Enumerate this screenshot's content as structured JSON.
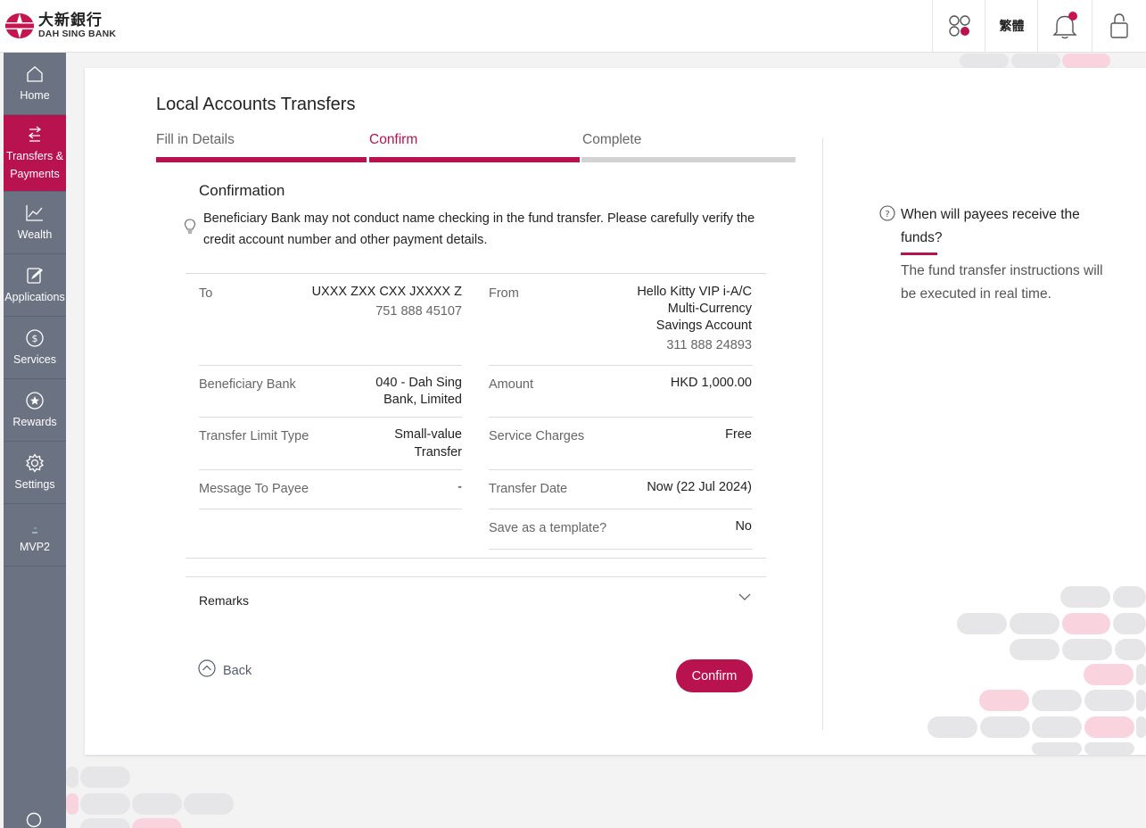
{
  "header": {
    "logo_cn": "大新銀行",
    "logo_en": "DAH SING BANK",
    "language_label": "繁體",
    "colors": {
      "brand": "#b8124f",
      "sidebar": "#6b7282"
    }
  },
  "sidebar": {
    "items": [
      {
        "label": "Home",
        "icon": "home-icon"
      },
      {
        "label": "Transfers & Payments",
        "icon": "transfer-icon"
      },
      {
        "label": "Wealth",
        "icon": "chart-icon"
      },
      {
        "label": "Applications",
        "icon": "edit-icon"
      },
      {
        "label": "Services",
        "icon": "dollar-icon"
      },
      {
        "label": "Rewards",
        "icon": "star-icon"
      },
      {
        "label": "Settings",
        "icon": "gear-icon"
      },
      {
        "label": "MVP2",
        "icon": "dash-icon"
      }
    ]
  },
  "page": {
    "title": "Local Accounts Transfers",
    "steps": [
      {
        "label": "Fill in Details",
        "state": "done"
      },
      {
        "label": "Confirm",
        "state": "active"
      },
      {
        "label": "Complete",
        "state": "pending"
      }
    ],
    "confirmation_heading": "Confirmation",
    "notice": "Beneficiary Bank may not conduct name checking in the fund transfer. Please carefully verify the credit account number and other payment details.",
    "details": {
      "to_label": "To",
      "to_name": "UXXX ZXX CXX JXXXX Z",
      "to_account": "751 888 45107",
      "from_label": "From",
      "from_line1": "Hello Kitty VIP i-A/C",
      "from_line2": "Multi-Currency",
      "from_line3": "Savings Account",
      "from_account": "311 888 24893",
      "bank_label": "Beneficiary Bank",
      "bank_line1": "040 - Dah Sing",
      "bank_line2": "Bank, Limited",
      "amount_label": "Amount",
      "amount_value": "HKD 1,000.00",
      "limit_label": "Transfer Limit Type",
      "limit_line1": "Small-value",
      "limit_line2": "Transfer",
      "charges_label": "Service Charges",
      "charges_value": "Free",
      "message_label": "Message To Payee",
      "message_value": "-",
      "date_label": "Transfer Date",
      "date_value": "Now (22 Jul 2024)",
      "template_label": "Save as a template?",
      "template_value": "No"
    },
    "remarks_label": "Remarks",
    "back_label": "Back",
    "confirm_label": "Confirm"
  },
  "faq": {
    "question": "When will payees receive the funds?",
    "answer": "The fund transfer instructions will be executed in real time."
  }
}
